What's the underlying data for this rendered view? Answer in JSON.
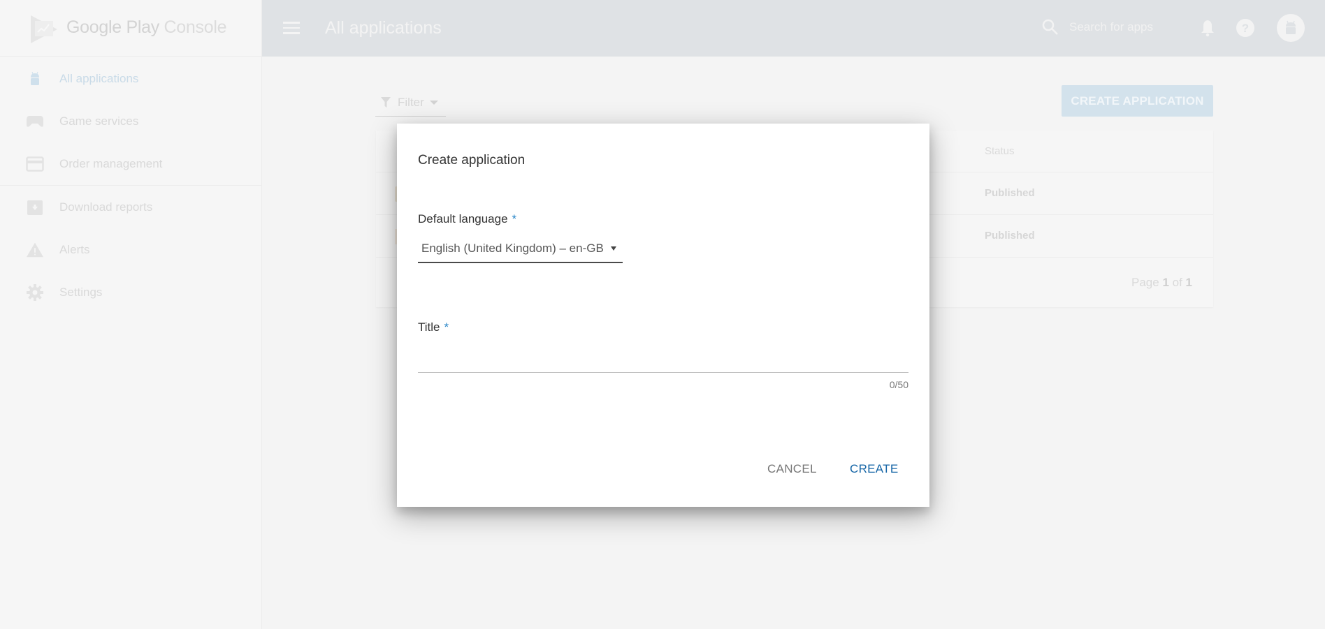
{
  "app": {
    "logo_text_bold": "Google Play",
    "logo_text_light": " Console"
  },
  "sidebar": {
    "items": [
      {
        "label": "All applications",
        "icon": "android-icon",
        "active": true
      },
      {
        "label": "Game services",
        "icon": "gamepad-icon",
        "active": false
      },
      {
        "label": "Order management",
        "icon": "credit-card-icon",
        "active": false
      },
      {
        "label": "Download reports",
        "icon": "download-box-icon",
        "active": false
      },
      {
        "label": "Alerts",
        "icon": "warning-icon",
        "active": false
      },
      {
        "label": "Settings",
        "icon": "gear-icon",
        "active": false
      }
    ]
  },
  "topbar": {
    "title": "All applications",
    "search_placeholder": "Search for apps"
  },
  "toolbar": {
    "filter_label": "Filter",
    "create_application_label": "CREATE APPLICATION"
  },
  "table": {
    "columns": {
      "status": "Status"
    },
    "rows": [
      {
        "status": "Published"
      },
      {
        "status": "Published"
      }
    ],
    "pager": {
      "prefix": "Page ",
      "current": "1",
      "of": " of ",
      "total": "1"
    }
  },
  "dialog": {
    "title": "Create application",
    "default_language_label": "Default language",
    "required_mark": "*",
    "default_language_value": "English (United Kingdom) – en-GB",
    "title_label": "Title",
    "title_value": "",
    "title_counter": "0/50",
    "cancel_label": "CANCEL",
    "create_label": "CREATE"
  },
  "colors": {
    "accent": "#1565a6",
    "required": "#2b87c8",
    "topbar_dimmed": "#dfe2e5"
  }
}
